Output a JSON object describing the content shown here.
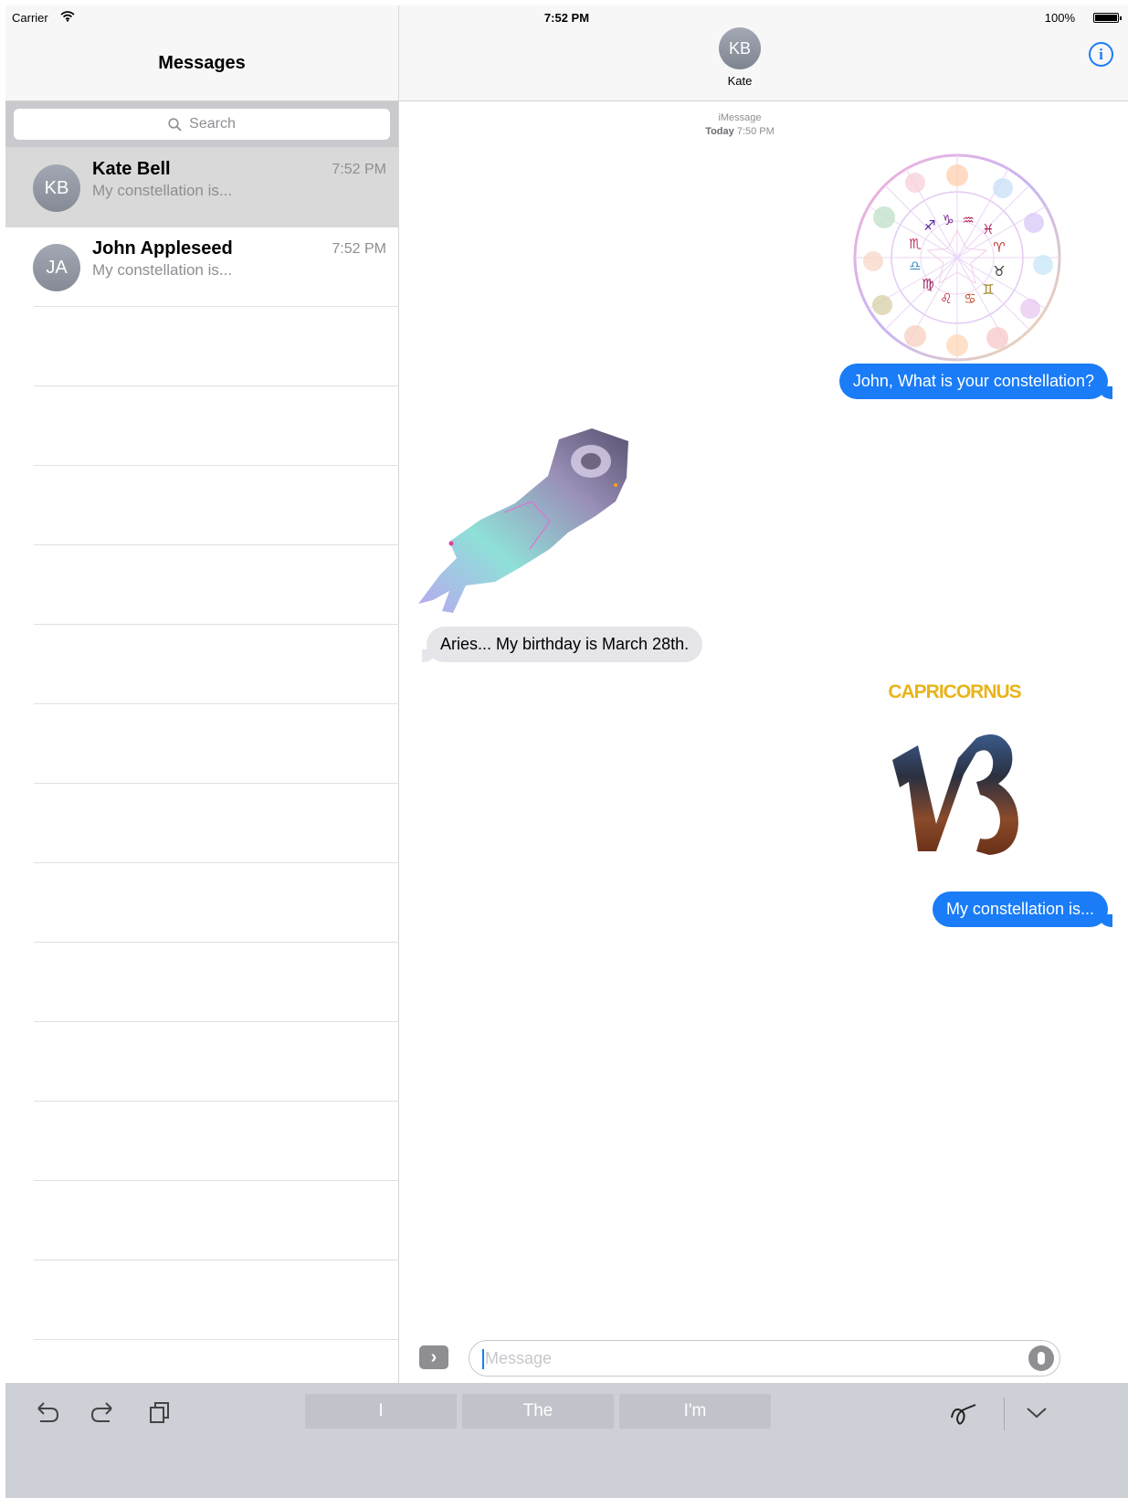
{
  "status_bar": {
    "carrier": "Carrier",
    "time": "7:52 PM",
    "battery": "100%"
  },
  "sidebar": {
    "title": "Messages",
    "search_placeholder": "Search",
    "conversations": [
      {
        "initials": "KB",
        "name": "Kate Bell",
        "preview": "My constellation is...",
        "time": "7:52 PM",
        "selected": true
      },
      {
        "initials": "JA",
        "name": "John Appleseed",
        "preview": "My constellation is...",
        "time": "7:52 PM",
        "selected": false
      }
    ]
  },
  "conversation": {
    "contact_initials": "KB",
    "contact_name": "Kate",
    "service_label": "iMessage",
    "timestamp_day": "Today",
    "timestamp_time": "7:50 PM",
    "messages": [
      {
        "type": "sticker",
        "direction": "outgoing",
        "sticker": "zodiac-wheel"
      },
      {
        "type": "text",
        "direction": "outgoing",
        "text": "John, What is your constellation?"
      },
      {
        "type": "sticker",
        "direction": "incoming",
        "sticker": "aries-ram"
      },
      {
        "type": "text",
        "direction": "incoming",
        "text": "Aries... My birthday is March 28th."
      },
      {
        "type": "sticker",
        "direction": "outgoing",
        "sticker": "capricornus",
        "sticker_title": "CAPRICORNUS"
      },
      {
        "type": "text",
        "direction": "outgoing",
        "text": "My constellation is..."
      }
    ],
    "input_placeholder": "Message"
  },
  "keyboard_bar": {
    "suggestions": [
      "I",
      "The",
      "I'm"
    ]
  },
  "colors": {
    "accent": "#1a7cf7",
    "incoming_bubble": "#e5e5ea",
    "keyboard_bar": "#cdd0d6"
  }
}
